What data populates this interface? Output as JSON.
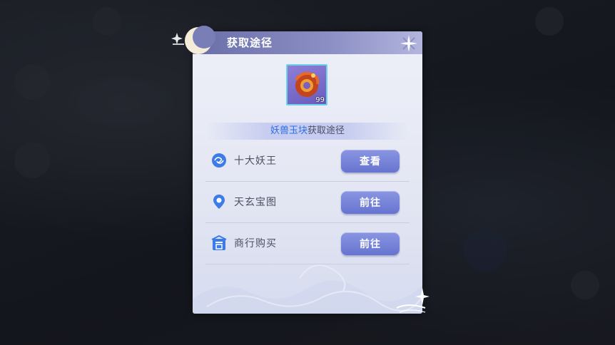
{
  "dialog": {
    "title": "获取途径",
    "item_count": "99",
    "subtitle_item": "妖兽玉块",
    "subtitle_rest": "获取途径"
  },
  "sources": [
    {
      "label": "十大妖王",
      "button": "查看",
      "icon": "swirl-icon"
    },
    {
      "label": "天玄宝图",
      "button": "前往",
      "icon": "map-pin-icon"
    },
    {
      "label": "商行购买",
      "button": "前往",
      "icon": "shop-icon"
    }
  ],
  "colors": {
    "accent": "#6674cf",
    "header": "#7b7fb8",
    "item_highlight": "#2f6fe0",
    "icon_blue": "#3d7ce8"
  }
}
